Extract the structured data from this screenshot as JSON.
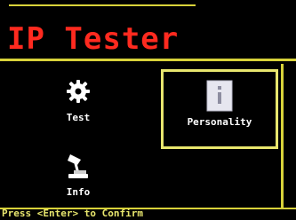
{
  "header": {
    "title": "IP Tester"
  },
  "menu": {
    "items": [
      {
        "label": "Test",
        "icon": "gear-icon"
      },
      {
        "label": "Personality",
        "icon": "document-info-icon",
        "selected": true
      },
      {
        "label": "Info",
        "icon": "desk-lamp-icon"
      }
    ]
  },
  "status": {
    "text": "Press <Enter> to Confirm"
  },
  "colors": {
    "title": "#ff2a1f",
    "accent": "#d8d23a",
    "highlight": "#e8e66e",
    "label": "#ffffff"
  }
}
